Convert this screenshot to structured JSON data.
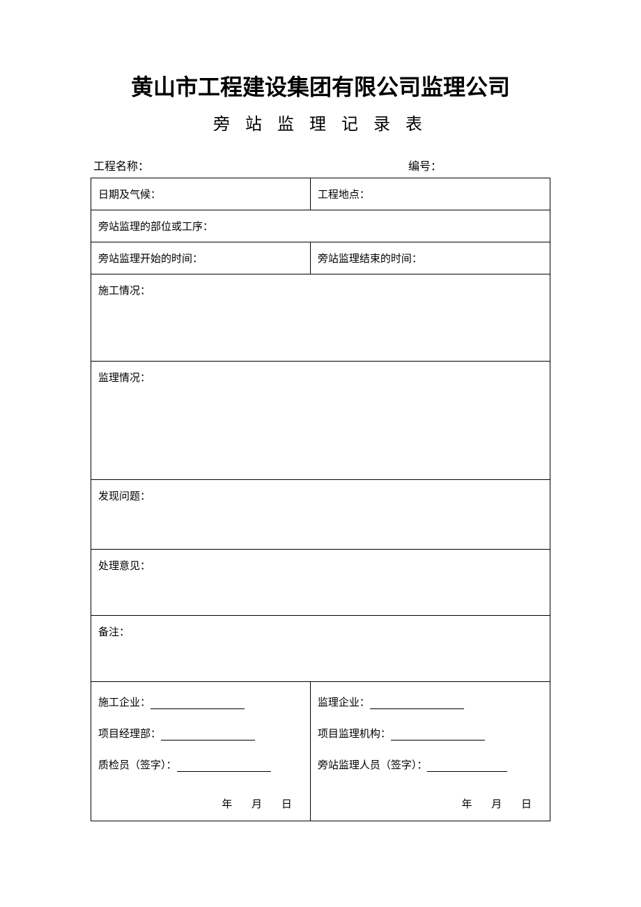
{
  "title": "黄山市工程建设集团有限公司监理公司",
  "subtitle": "旁 站 监 理 记 录 表",
  "header": {
    "project_name_label": "工程名称：",
    "serial_label": "编号："
  },
  "rows": {
    "date_weather": "日期及气候：",
    "project_location": "工程地点：",
    "supervision_part": "旁站监理的部位或工序：",
    "start_time": "旁站监理开始的时间：",
    "end_time": "旁站监理结束的时间：",
    "construction_status": "施工情况：",
    "supervision_status": "监理情况：",
    "problems_found": "发现问题：",
    "handling_opinion": "处理意见：",
    "remarks": "备注："
  },
  "sig_left": {
    "enterprise": "施工企业：",
    "dept": "项目经理部：",
    "inspector": "质检员（签字）：",
    "year": "年",
    "month": "月",
    "day": "日"
  },
  "sig_right": {
    "enterprise": "监理企业：",
    "org": "项目监理机构：",
    "supervisor": "旁站监理人员（签字）：",
    "year": "年",
    "month": "月",
    "day": "日"
  }
}
